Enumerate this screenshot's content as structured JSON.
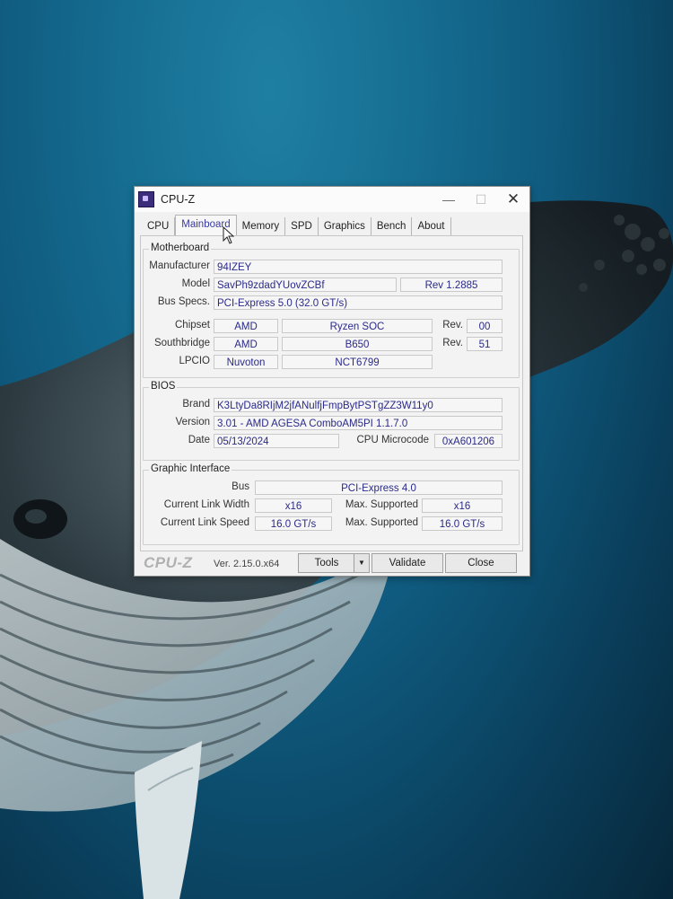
{
  "window": {
    "title": "CPU-Z",
    "minimize_glyph": "—",
    "maximize_glyph": "☐",
    "close_glyph": "✕"
  },
  "tabs": [
    {
      "label": "CPU",
      "active": false
    },
    {
      "label": "Mainboard",
      "active": true
    },
    {
      "label": "Memory",
      "active": false
    },
    {
      "label": "SPD",
      "active": false
    },
    {
      "label": "Graphics",
      "active": false
    },
    {
      "label": "Bench",
      "active": false
    },
    {
      "label": "About",
      "active": false
    }
  ],
  "motherboard": {
    "group_label": "Motherboard",
    "manufacturer_label": "Manufacturer",
    "manufacturer": "94IZEY",
    "model_label": "Model",
    "model": "SavPh9zdadYUovZCBf",
    "model_rev": "Rev 1.2885",
    "bus_specs_label": "Bus Specs.",
    "bus_specs": "PCI-Express 5.0 (32.0 GT/s)",
    "chipset_label": "Chipset",
    "chipset_vendor": "AMD",
    "chipset_name": "Ryzen SOC",
    "chipset_rev_label": "Rev.",
    "chipset_rev": "00",
    "southbridge_label": "Southbridge",
    "southbridge_vendor": "AMD",
    "southbridge_name": "B650",
    "southbridge_rev_label": "Rev.",
    "southbridge_rev": "51",
    "lpcio_label": "LPCIO",
    "lpcio_vendor": "Nuvoton",
    "lpcio_name": "NCT6799"
  },
  "bios": {
    "group_label": "BIOS",
    "brand_label": "Brand",
    "brand": "K3LtyDa8RIjM2jfANulfjFmpBytPSTgZZ3W11y0",
    "version_label": "Version",
    "version": "3.01 - AMD AGESA ComboAM5PI 1.1.7.0",
    "date_label": "Date",
    "date": "05/13/2024",
    "microcode_label": "CPU Microcode",
    "microcode": "0xA601206"
  },
  "graphic_interface": {
    "group_label": "Graphic Interface",
    "bus_label": "Bus",
    "bus": "PCI-Express 4.0",
    "link_width_label": "Current Link Width",
    "link_width": "x16",
    "max_width_label": "Max. Supported",
    "max_width": "x16",
    "link_speed_label": "Current Link Speed",
    "link_speed": "16.0 GT/s",
    "max_speed_label": "Max. Supported",
    "max_speed": "16.0 GT/s"
  },
  "footer": {
    "brand": "CPU-Z",
    "version": "Ver. 2.15.0.x64",
    "tools_label": "Tools",
    "tools_arrow": "▼",
    "validate_label": "Validate",
    "close_label": "Close"
  }
}
